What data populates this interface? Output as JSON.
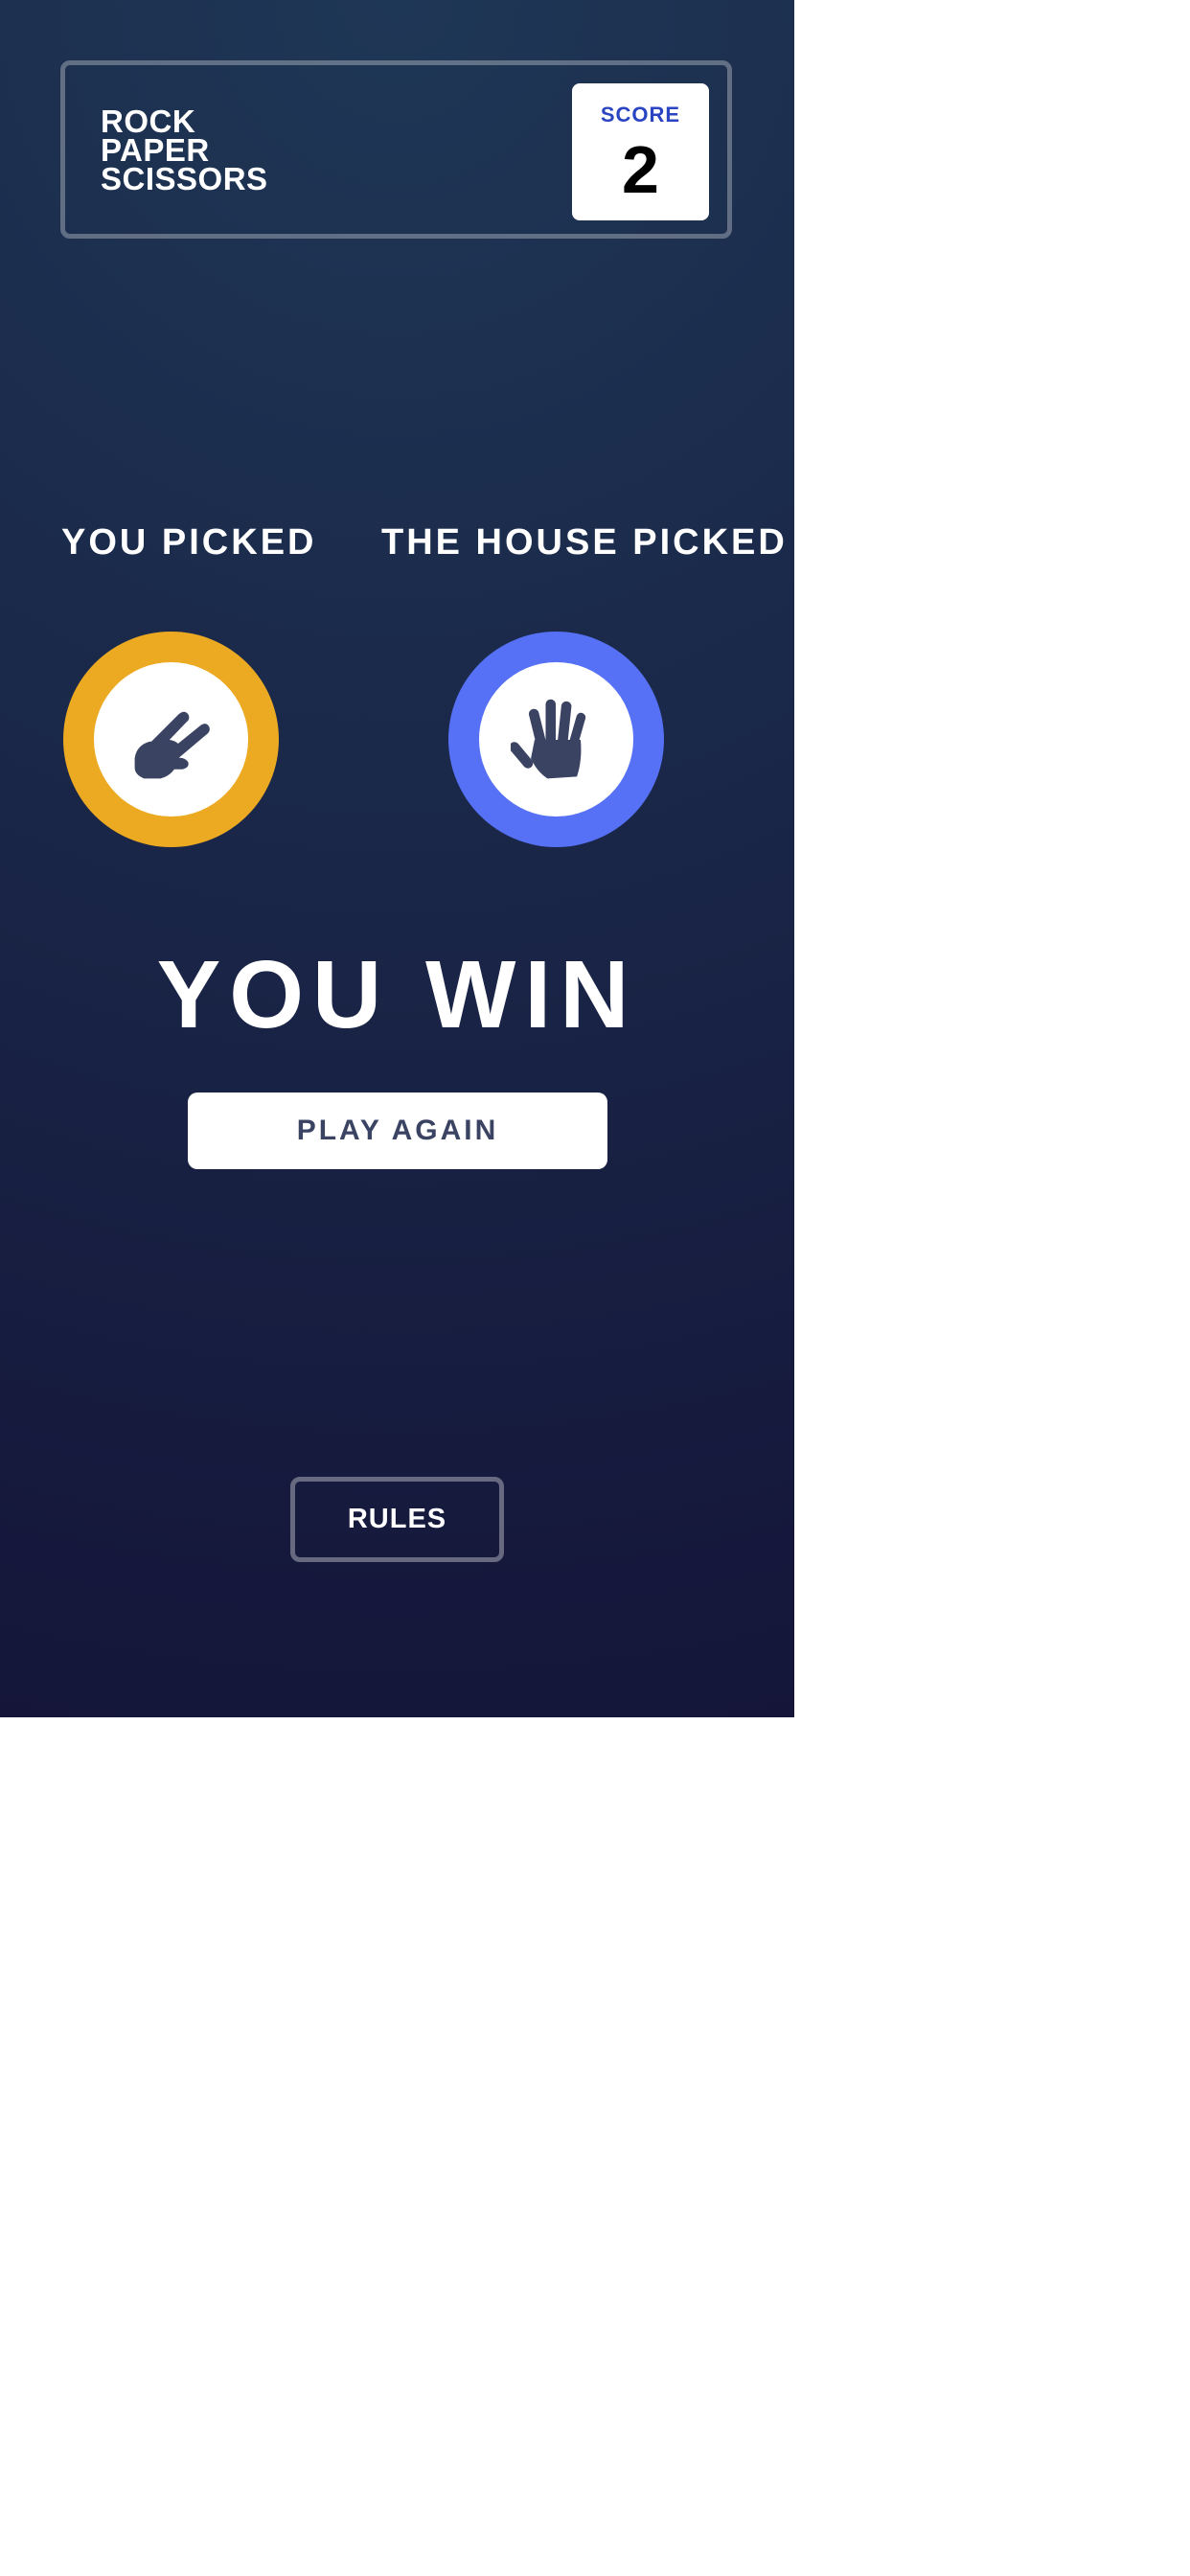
{
  "header": {
    "title_lines": [
      "ROCK",
      "PAPER",
      "SCISSORS"
    ],
    "score_label": "SCORE",
    "score_value": "2"
  },
  "player": {
    "label": "YOU PICKED",
    "choice": "scissors",
    "icon": "scissors-icon",
    "color": "#eca922"
  },
  "house": {
    "label": "THE HOUSE PICKED",
    "choice": "paper",
    "icon": "paper-icon",
    "color": "#5671f5"
  },
  "result": {
    "text": "YOU WIN",
    "button_label": "PLAY AGAIN"
  },
  "footer": {
    "rules_label": "RULES"
  },
  "colors": {
    "background_top": "#1f3756",
    "background_bottom": "#141539",
    "icon_fill": "#3b4363",
    "score_label": "#2a45c2"
  }
}
